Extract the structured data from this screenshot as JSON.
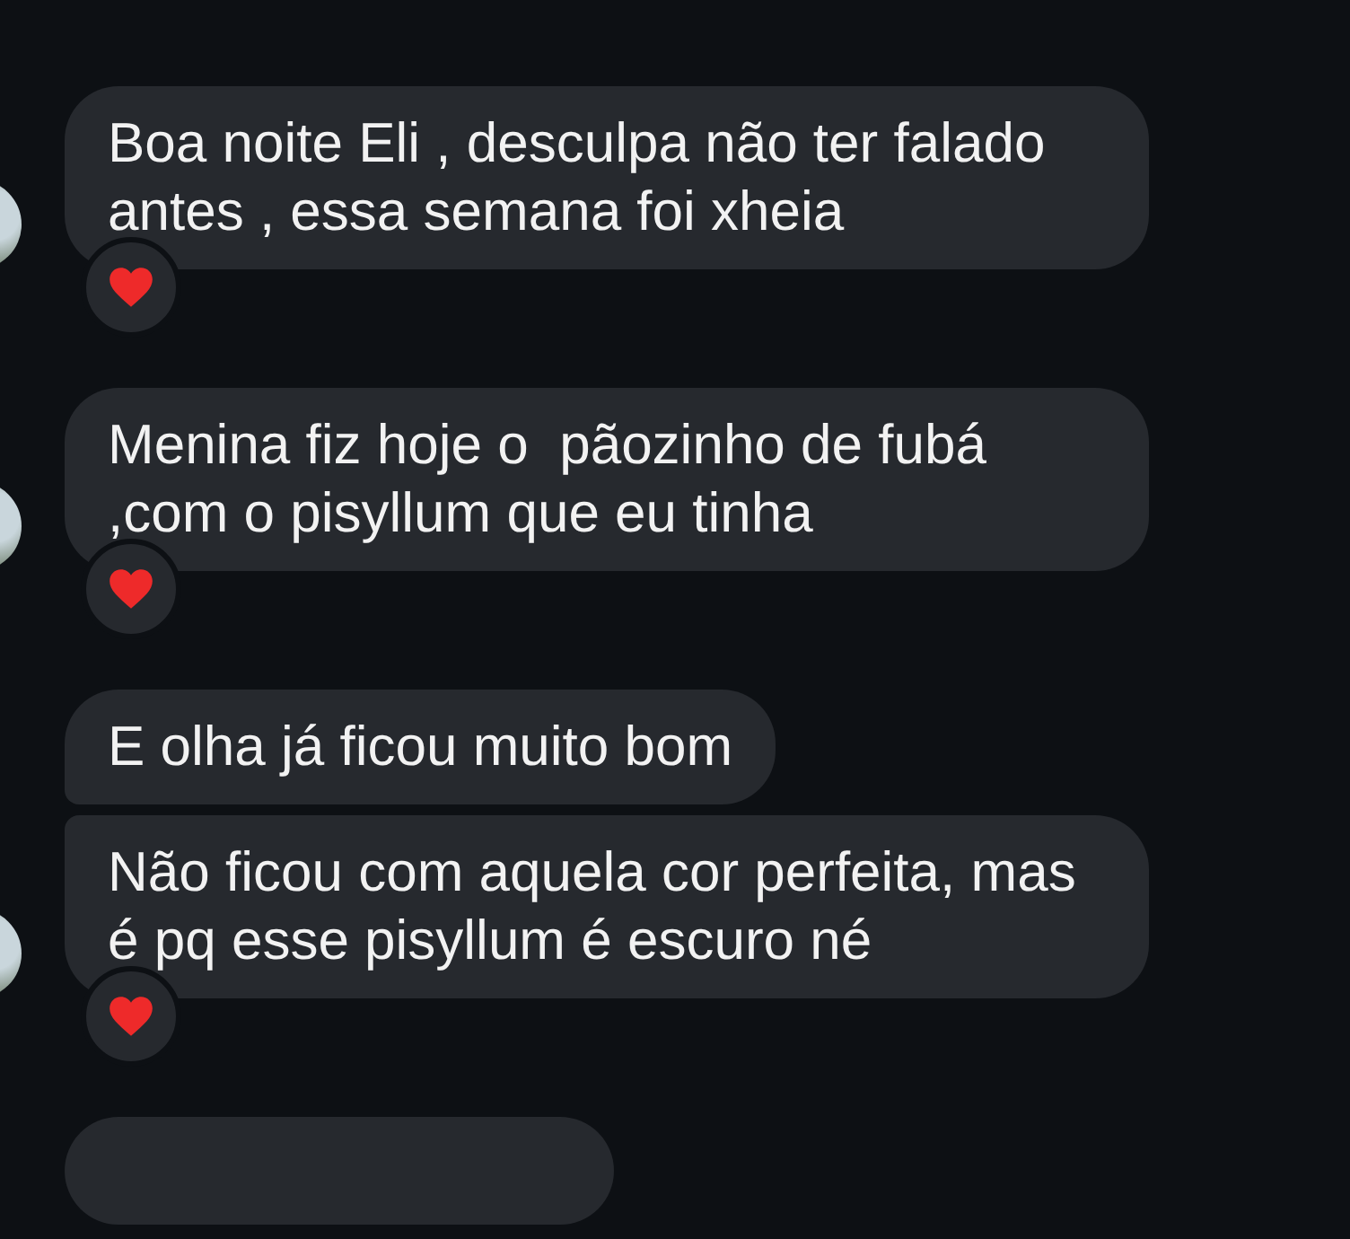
{
  "groups": [
    {
      "messages": [
        {
          "text": "Boa noite Eli , desculpa não ter falado antes , essa semana foi xheia",
          "reacted": true
        }
      ]
    },
    {
      "messages": [
        {
          "text": "Menina fiz hoje o  pãozinho de fubá ,com o pisyllum que eu tinha",
          "reacted": true
        }
      ]
    },
    {
      "messages": [
        {
          "text": "E olha já ficou muito bom",
          "reacted": false
        },
        {
          "text": "Não ficou com aquela cor perfeita, mas é pq esse pisyllum é escuro né",
          "reacted": true
        }
      ]
    }
  ]
}
